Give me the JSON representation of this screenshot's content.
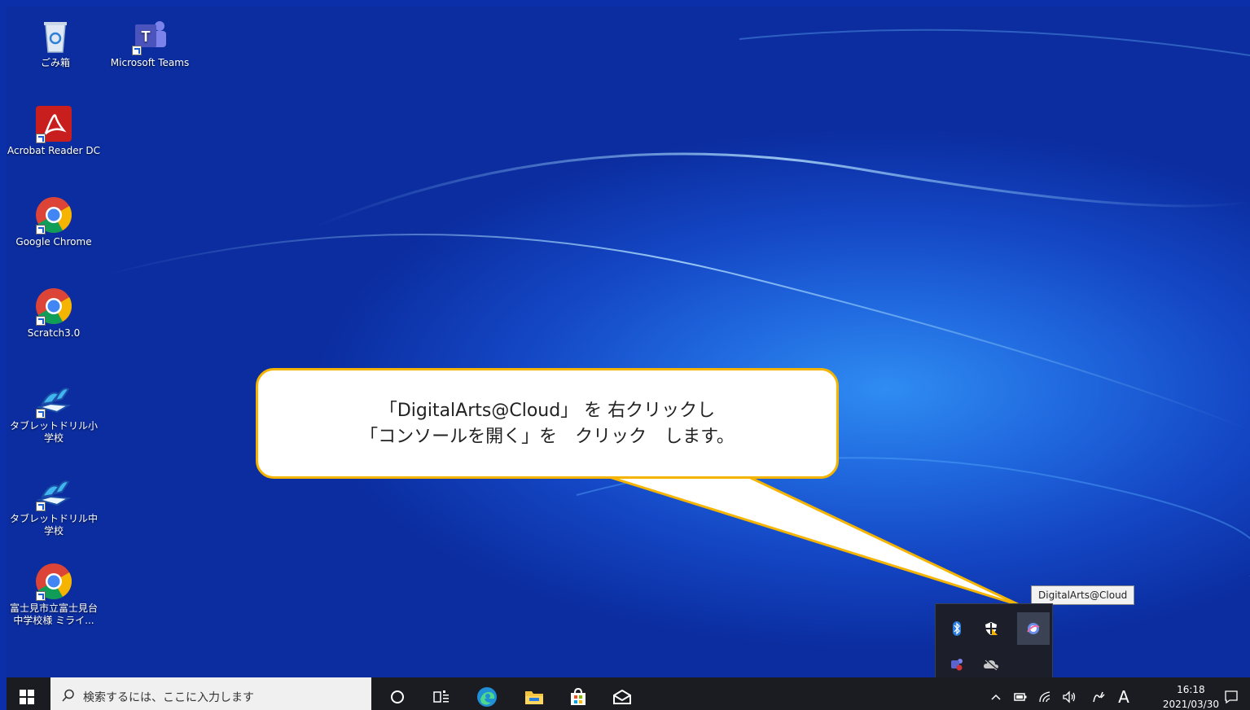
{
  "desktop": {
    "icons": [
      {
        "label": "ごみ箱",
        "icon": "recycle-bin-icon"
      },
      {
        "label": "Microsoft Teams",
        "icon": "teams-icon"
      },
      {
        "label": "Acrobat Reader DC",
        "icon": "acrobat-icon"
      },
      {
        "label": "Google Chrome",
        "icon": "chrome-icon"
      },
      {
        "label": "Scratch3.0",
        "icon": "chrome-icon"
      },
      {
        "label": "タブレットドリル小学校",
        "icon": "tablet-drill-icon"
      },
      {
        "label": "タブレットドリル中学校",
        "icon": "tablet-drill-icon"
      },
      {
        "label": "富士見市立富士見台中学校様 ミライ...",
        "icon": "chrome-icon"
      }
    ]
  },
  "callout": {
    "line1": "「DigitalArts@Cloud」 を 右クリックし",
    "line2": "「コンソールを開く」を　クリック　します。"
  },
  "tray": {
    "tooltip": "DigitalArts@Cloud",
    "icons": [
      "bluetooth-icon",
      "security-shield-icon",
      "digitalarts-cloud-icon",
      "teams-tray-icon",
      "onedrive-icon"
    ]
  },
  "taskbar": {
    "search_placeholder": "検索するには、ここに入力します",
    "time": "16:18",
    "date": "2021/03/30",
    "ime": "A"
  },
  "colors": {
    "callout_border": "#f5b400",
    "taskbar_bg": "#1b1c22",
    "desktop_blue": "#1446c4"
  }
}
